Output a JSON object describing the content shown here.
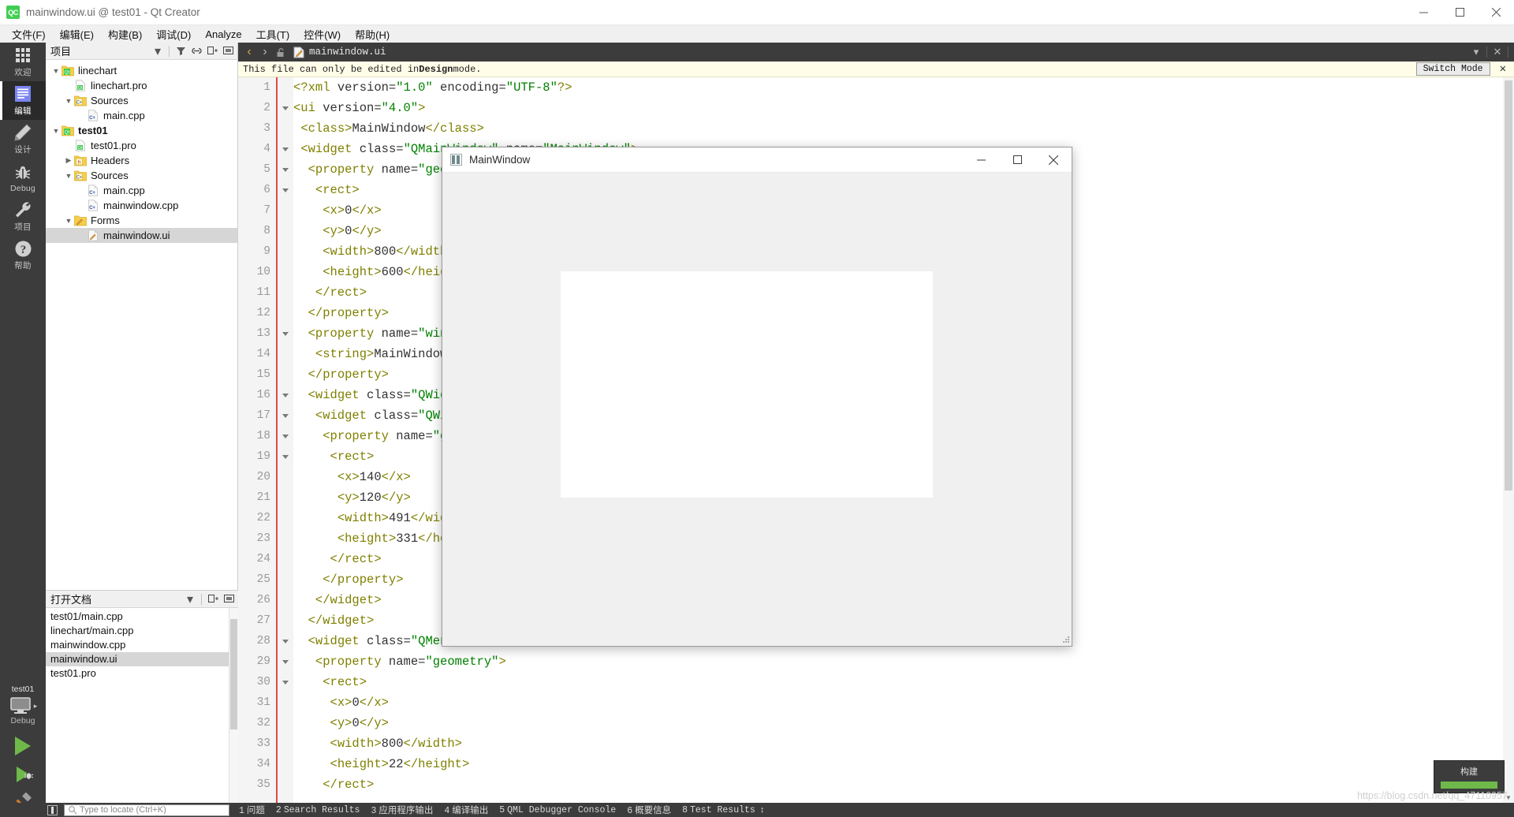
{
  "window": {
    "title": "mainwindow.ui @ test01 - Qt Creator",
    "logo_text": "QC",
    "minimize": "─",
    "maximize": "□",
    "close": "✕"
  },
  "menubar": {
    "items": [
      {
        "label": "文件(F)"
      },
      {
        "label": "编辑(E)"
      },
      {
        "label": "构建(B)"
      },
      {
        "label": "调试(D)"
      },
      {
        "label": "Analyze"
      },
      {
        "label": "工具(T)"
      },
      {
        "label": "控件(W)"
      },
      {
        "label": "帮助(H)"
      }
    ]
  },
  "modebar": {
    "items": [
      {
        "label": "欢迎",
        "icon": "grid-icon",
        "active": false
      },
      {
        "label": "编辑",
        "icon": "document-lines-icon",
        "active": true
      },
      {
        "label": "设计",
        "icon": "pencil-icon",
        "active": false
      },
      {
        "label": "Debug",
        "icon": "bug-icon",
        "active": false
      },
      {
        "label": "项目",
        "icon": "wrench-icon",
        "active": false
      },
      {
        "label": "帮助",
        "icon": "question-mark-icon",
        "active": false
      }
    ],
    "kit": {
      "project": "test01",
      "build_config": "Debug",
      "run_button": "run-icon",
      "debug_button": "run-debug-icon",
      "build_button": "hammer-icon"
    }
  },
  "project_panel": {
    "title": "项目",
    "header_icons": [
      "filter-icon",
      "link-icon",
      "split-icon",
      "collapse-icon"
    ],
    "tree": [
      {
        "depth": 0,
        "chev": "down",
        "icon": "qt-project-icon",
        "label": "linechart",
        "bold": false,
        "selected": false
      },
      {
        "depth": 1,
        "chev": "none",
        "icon": "pro-file-icon",
        "label": "linechart.pro",
        "bold": false,
        "selected": false
      },
      {
        "depth": 1,
        "chev": "down",
        "icon": "cpp-folder-icon",
        "label": "Sources",
        "bold": false,
        "selected": false
      },
      {
        "depth": 2,
        "chev": "none",
        "icon": "cpp-file-icon",
        "label": "main.cpp",
        "bold": false,
        "selected": false
      },
      {
        "depth": 0,
        "chev": "down",
        "icon": "qt-project-icon",
        "label": "test01",
        "bold": true,
        "selected": false
      },
      {
        "depth": 1,
        "chev": "none",
        "icon": "pro-file-icon",
        "label": "test01.pro",
        "bold": false,
        "selected": false
      },
      {
        "depth": 1,
        "chev": "right",
        "icon": "h-folder-icon",
        "label": "Headers",
        "bold": false,
        "selected": false
      },
      {
        "depth": 1,
        "chev": "down",
        "icon": "cpp-folder-icon",
        "label": "Sources",
        "bold": false,
        "selected": false
      },
      {
        "depth": 2,
        "chev": "none",
        "icon": "cpp-file-icon",
        "label": "main.cpp",
        "bold": false,
        "selected": false
      },
      {
        "depth": 2,
        "chev": "none",
        "icon": "cpp-file-icon",
        "label": "mainwindow.cpp",
        "bold": false,
        "selected": false
      },
      {
        "depth": 1,
        "chev": "down",
        "icon": "forms-folder-icon",
        "label": "Forms",
        "bold": false,
        "selected": false
      },
      {
        "depth": 2,
        "chev": "none",
        "icon": "ui-file-icon",
        "label": "mainwindow.ui",
        "bold": false,
        "selected": true
      }
    ]
  },
  "open_documents": {
    "title": "打开文档",
    "header_icons": [
      "split-icon",
      "collapse-icon"
    ],
    "items": [
      {
        "label": "test01/main.cpp",
        "selected": false
      },
      {
        "label": "linechart/main.cpp",
        "selected": false
      },
      {
        "label": "mainwindow.cpp",
        "selected": false
      },
      {
        "label": "mainwindow.ui",
        "selected": true
      },
      {
        "label": "test01.pro",
        "selected": false
      }
    ]
  },
  "editor": {
    "tab_label": "mainwindow.ui",
    "nav_back": "‹",
    "nav_forward": "›",
    "lock_icon": "unlocked-icon",
    "file_icon": "ui-file-icon",
    "dropdown": "▾",
    "close": "✕",
    "infobar": {
      "text_before": "This file can only be edited in ",
      "text_bold": "Design",
      "text_after": " mode.",
      "switch_mode_label": "Switch Mode",
      "close_label": "✕"
    },
    "lines": [
      {
        "n": 1,
        "fold": false,
        "text": "<?xml version=\"1.0\" encoding=\"UTF-8\"?>"
      },
      {
        "n": 2,
        "fold": true,
        "text": "<ui version=\"4.0\">"
      },
      {
        "n": 3,
        "fold": false,
        "text": " <class>MainWindow</class>"
      },
      {
        "n": 4,
        "fold": true,
        "text": " <widget class=\"QMainWindow\" name=\"MainWindow\">"
      },
      {
        "n": 5,
        "fold": true,
        "text": "  <property name=\"geometry\">"
      },
      {
        "n": 6,
        "fold": true,
        "text": "   <rect>"
      },
      {
        "n": 7,
        "fold": false,
        "text": "    <x>0</x>"
      },
      {
        "n": 8,
        "fold": false,
        "text": "    <y>0</y>"
      },
      {
        "n": 9,
        "fold": false,
        "text": "    <width>800</width>"
      },
      {
        "n": 10,
        "fold": false,
        "text": "    <height>600</height>"
      },
      {
        "n": 11,
        "fold": false,
        "text": "   </rect>"
      },
      {
        "n": 12,
        "fold": false,
        "text": "  </property>"
      },
      {
        "n": 13,
        "fold": true,
        "text": "  <property name=\"windowTitle\">"
      },
      {
        "n": 14,
        "fold": false,
        "text": "   <string>MainWindow</string>"
      },
      {
        "n": 15,
        "fold": false,
        "text": "  </property>"
      },
      {
        "n": 16,
        "fold": true,
        "text": "  <widget class=\"QWidget\" name=\"centralWidget\">"
      },
      {
        "n": 17,
        "fold": true,
        "text": "   <widget class=\"QWidget\" name=\"widget\">"
      },
      {
        "n": 18,
        "fold": true,
        "text": "    <property name=\"geometry\">"
      },
      {
        "n": 19,
        "fold": true,
        "text": "     <rect>"
      },
      {
        "n": 20,
        "fold": false,
        "text": "      <x>140</x>"
      },
      {
        "n": 21,
        "fold": false,
        "text": "      <y>120</y>"
      },
      {
        "n": 22,
        "fold": false,
        "text": "      <width>491</width>"
      },
      {
        "n": 23,
        "fold": false,
        "text": "      <height>331</height>"
      },
      {
        "n": 24,
        "fold": false,
        "text": "     </rect>"
      },
      {
        "n": 25,
        "fold": false,
        "text": "    </property>"
      },
      {
        "n": 26,
        "fold": false,
        "text": "   </widget>"
      },
      {
        "n": 27,
        "fold": false,
        "text": "  </widget>"
      },
      {
        "n": 28,
        "fold": true,
        "text": "  <widget class=\"QMenuBar\" name=\"menuBar\">"
      },
      {
        "n": 29,
        "fold": true,
        "text": "   <property name=\"geometry\">"
      },
      {
        "n": 30,
        "fold": true,
        "text": "    <rect>"
      },
      {
        "n": 31,
        "fold": false,
        "text": "     <x>0</x>"
      },
      {
        "n": 32,
        "fold": false,
        "text": "     <y>0</y>"
      },
      {
        "n": 33,
        "fold": false,
        "text": "     <width>800</width>"
      },
      {
        "n": 34,
        "fold": false,
        "text": "     <height>22</height>"
      },
      {
        "n": 35,
        "fold": false,
        "text": "    </rect>"
      }
    ]
  },
  "app_window": {
    "title": "MainWindow",
    "minimize": "─",
    "maximize": "□",
    "close": "✕"
  },
  "statusbar": {
    "sidebar_toggle": "sidebar-toggle-icon",
    "locate_placeholder": "Type to locate (Ctrl+K)",
    "items": [
      {
        "num": "1",
        "label": "问题"
      },
      {
        "num": "2",
        "label": "Search Results"
      },
      {
        "num": "3",
        "label": "应用程序输出"
      },
      {
        "num": "4",
        "label": "编译输出"
      },
      {
        "num": "5",
        "label": "QML Debugger Console"
      },
      {
        "num": "6",
        "label": "概要信息"
      },
      {
        "num": "8",
        "label": "Test Results"
      }
    ],
    "updown": "↕"
  },
  "build_progress": {
    "label": "构建",
    "percent": 100
  },
  "watermark": "https://blog.csdn.net/qq_47110957",
  "colors": {
    "accent_green": "#41cd52",
    "mode_bar_bg": "#3c3c3c",
    "selection": "#d6d6d6",
    "infobar_bg": "#fffde8",
    "error_bar": "#e04a3f",
    "annotation_arrow": "#7ec8ee"
  }
}
